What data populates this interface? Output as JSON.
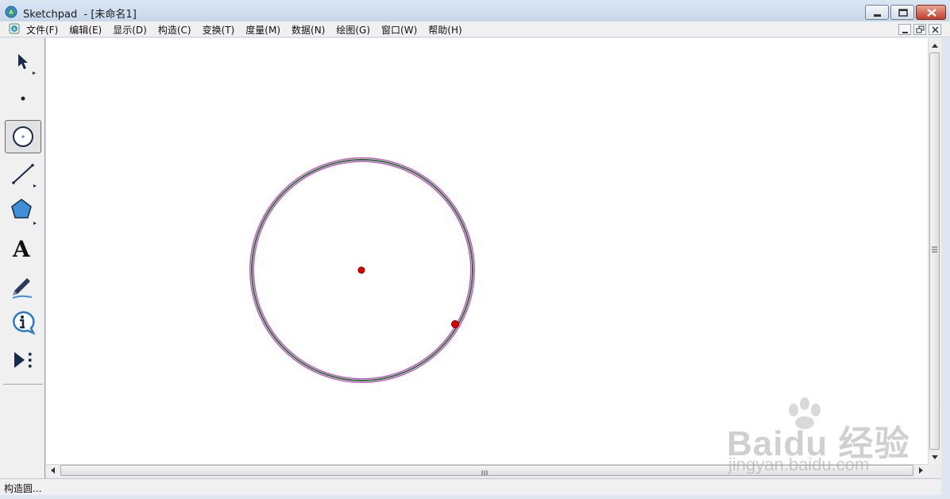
{
  "window": {
    "title": "Sketchpad  - [未命名1]"
  },
  "menu": {
    "items": [
      "文件(F)",
      "编辑(E)",
      "显示(D)",
      "构造(C)",
      "变换(T)",
      "度量(M)",
      "数据(N)",
      "绘图(G)",
      "窗口(W)",
      "帮助(H)"
    ]
  },
  "toolbox": {
    "tools": [
      {
        "name": "selection-arrow-tool",
        "icon": "arrow-cursor-icon",
        "selected": false
      },
      {
        "name": "point-tool",
        "icon": "point-icon",
        "selected": false
      },
      {
        "name": "compass-tool",
        "icon": "circle-icon",
        "selected": true
      },
      {
        "name": "straightedge-tool",
        "icon": "line-segment-icon",
        "selected": false
      },
      {
        "name": "polygon-tool",
        "icon": "pentagon-icon",
        "selected": false
      },
      {
        "name": "text-tool",
        "icon": "text-a-icon",
        "selected": false
      },
      {
        "name": "marker-tool",
        "icon": "pen-icon",
        "selected": false
      },
      {
        "name": "information-tool",
        "icon": "info-icon",
        "selected": false
      },
      {
        "name": "custom-tool",
        "icon": "play-menu-icon",
        "selected": false
      }
    ]
  },
  "canvas": {
    "circle": {
      "stroke_color": "#1f7a2a",
      "highlight_color": "#d04fd0",
      "selected": true
    },
    "center_point": {
      "color": "#e00000"
    },
    "radius_point": {
      "color": "#e00000"
    }
  },
  "status": {
    "text": "构造圆..."
  },
  "watermark": {
    "logo": "Baidu 经验",
    "url": "jingyan.baidu.com"
  }
}
